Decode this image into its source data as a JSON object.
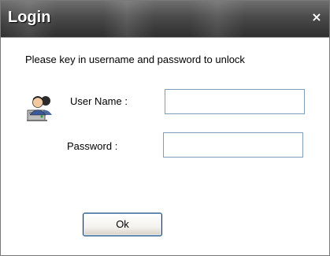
{
  "window": {
    "title": "Login",
    "close_glyph": "×"
  },
  "form": {
    "instruction": "Please key in username and password to unlock",
    "username_label": "User Name :",
    "username_value": "",
    "password_label": "Password :",
    "password_value": "",
    "ok_label": "Ok"
  },
  "icons": {
    "user": "user-computer-icon",
    "close": "close-icon"
  },
  "colors": {
    "titlebar": "#3f3f3f",
    "input_border": "#7f9db9",
    "button_border": "#003c74"
  }
}
